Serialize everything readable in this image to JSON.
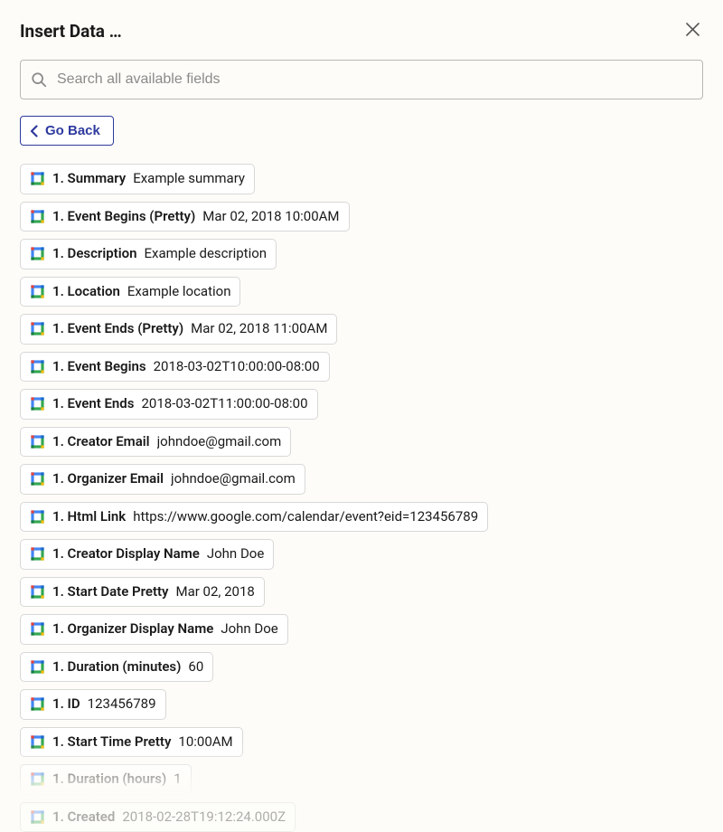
{
  "header": {
    "title": "Insert Data …"
  },
  "search": {
    "placeholder": "Search all available fields"
  },
  "go_back": {
    "label": "Go Back"
  },
  "fields": [
    {
      "label": "1. Summary",
      "value": "Example summary"
    },
    {
      "label": "1. Event Begins (Pretty)",
      "value": "Mar 02, 2018 10:00AM"
    },
    {
      "label": "1. Description",
      "value": "Example description"
    },
    {
      "label": "1. Location",
      "value": "Example location"
    },
    {
      "label": "1. Event Ends (Pretty)",
      "value": "Mar 02, 2018 11:00AM"
    },
    {
      "label": "1. Event Begins",
      "value": "2018-03-02T10:00:00-08:00"
    },
    {
      "label": "1. Event Ends",
      "value": "2018-03-02T11:00:00-08:00"
    },
    {
      "label": "1. Creator Email",
      "value": "johndoe@gmail.com"
    },
    {
      "label": "1. Organizer Email",
      "value": "johndoe@gmail.com"
    },
    {
      "label": "1. Html Link",
      "value": "https://www.google.com/calendar/event?eid=123456789"
    },
    {
      "label": "1. Creator Display Name",
      "value": "John Doe"
    },
    {
      "label": "1. Start Date Pretty",
      "value": "Mar 02, 2018"
    },
    {
      "label": "1. Organizer Display Name",
      "value": "John Doe"
    },
    {
      "label": "1. Duration (minutes)",
      "value": "60"
    },
    {
      "label": "1. ID",
      "value": "123456789"
    },
    {
      "label": "1. Start Time Pretty",
      "value": "10:00AM"
    },
    {
      "label": "1. Duration (hours)",
      "value": "1"
    },
    {
      "label": "1. Created",
      "value": "2018-02-28T19:12:24.000Z",
      "faded": true
    }
  ],
  "icons": {
    "calendar": "google-calendar-icon"
  }
}
